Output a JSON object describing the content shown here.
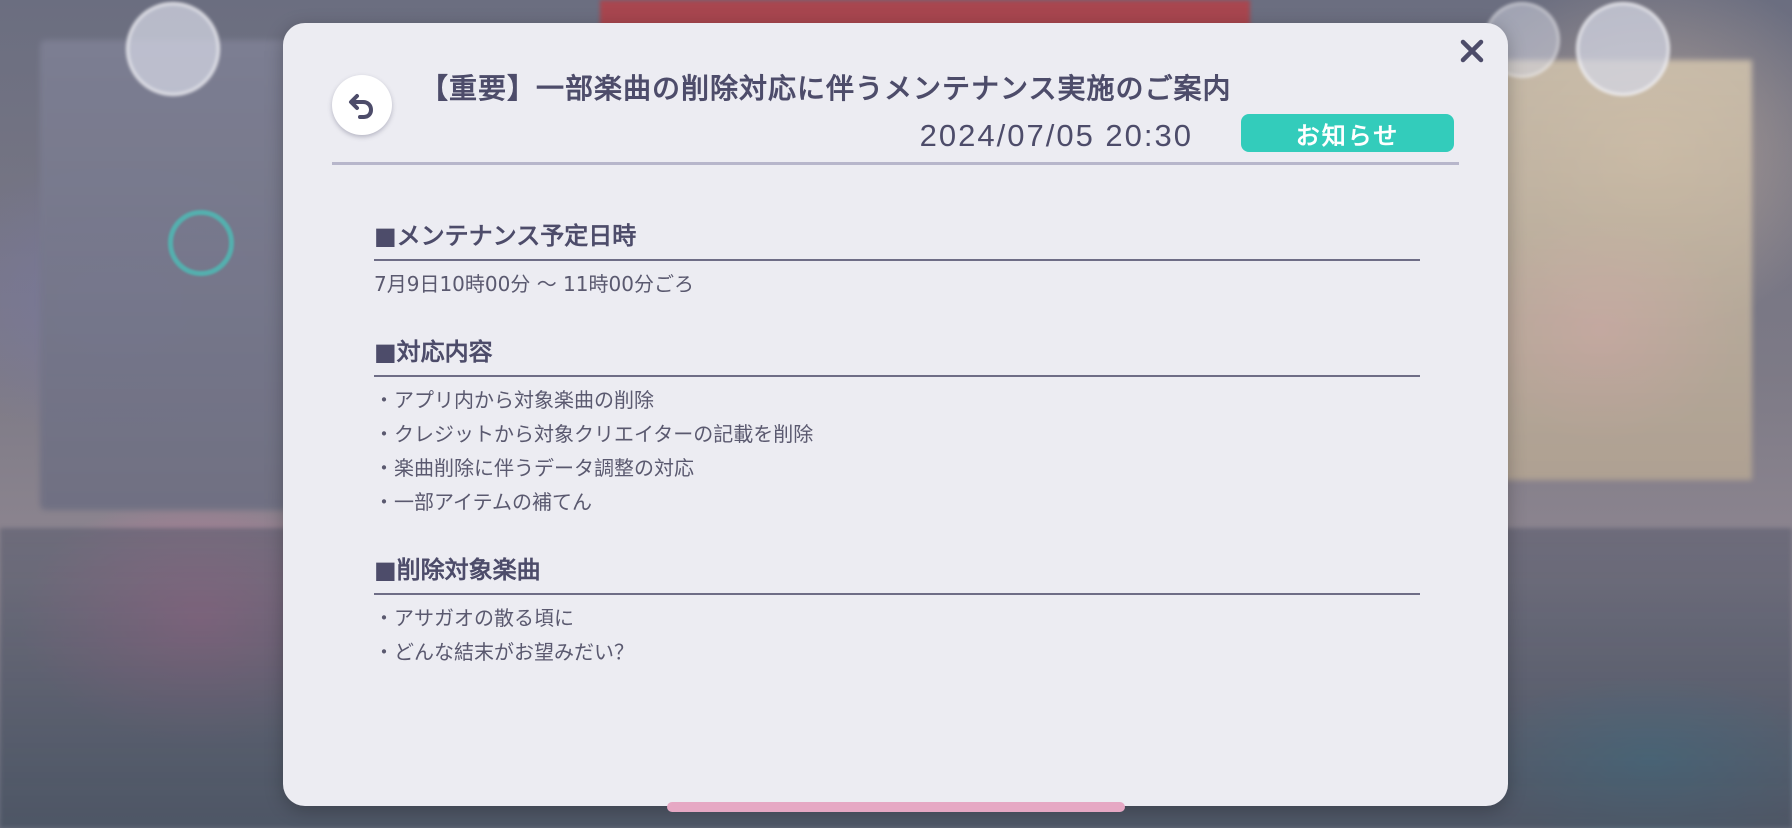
{
  "dialog": {
    "title": "【重要】一部楽曲の削除対応に伴うメンテナンス実施のご案内",
    "date": "2024/07/05 20:30",
    "category": "お知らせ",
    "close_icon": "close-icon",
    "back_icon": "back-arrow-icon",
    "category_color": "#33ccbb"
  },
  "sections": [
    {
      "heading": "■メンテナンス予定日時",
      "text": "7月9日10時00分 〜 11時00分ごろ"
    },
    {
      "heading": "■対応内容",
      "items": [
        "・アプリ内から対象楽曲の削除",
        "・クレジットから対象クリエイターの記載を削除",
        "・楽曲削除に伴うデータ調整の対応",
        "・一部アイテムの補てん"
      ]
    },
    {
      "heading": "■削除対象楽曲",
      "items": [
        "・アサガオの散る頃に",
        "・どんな結末がお望みだい？"
      ]
    }
  ]
}
